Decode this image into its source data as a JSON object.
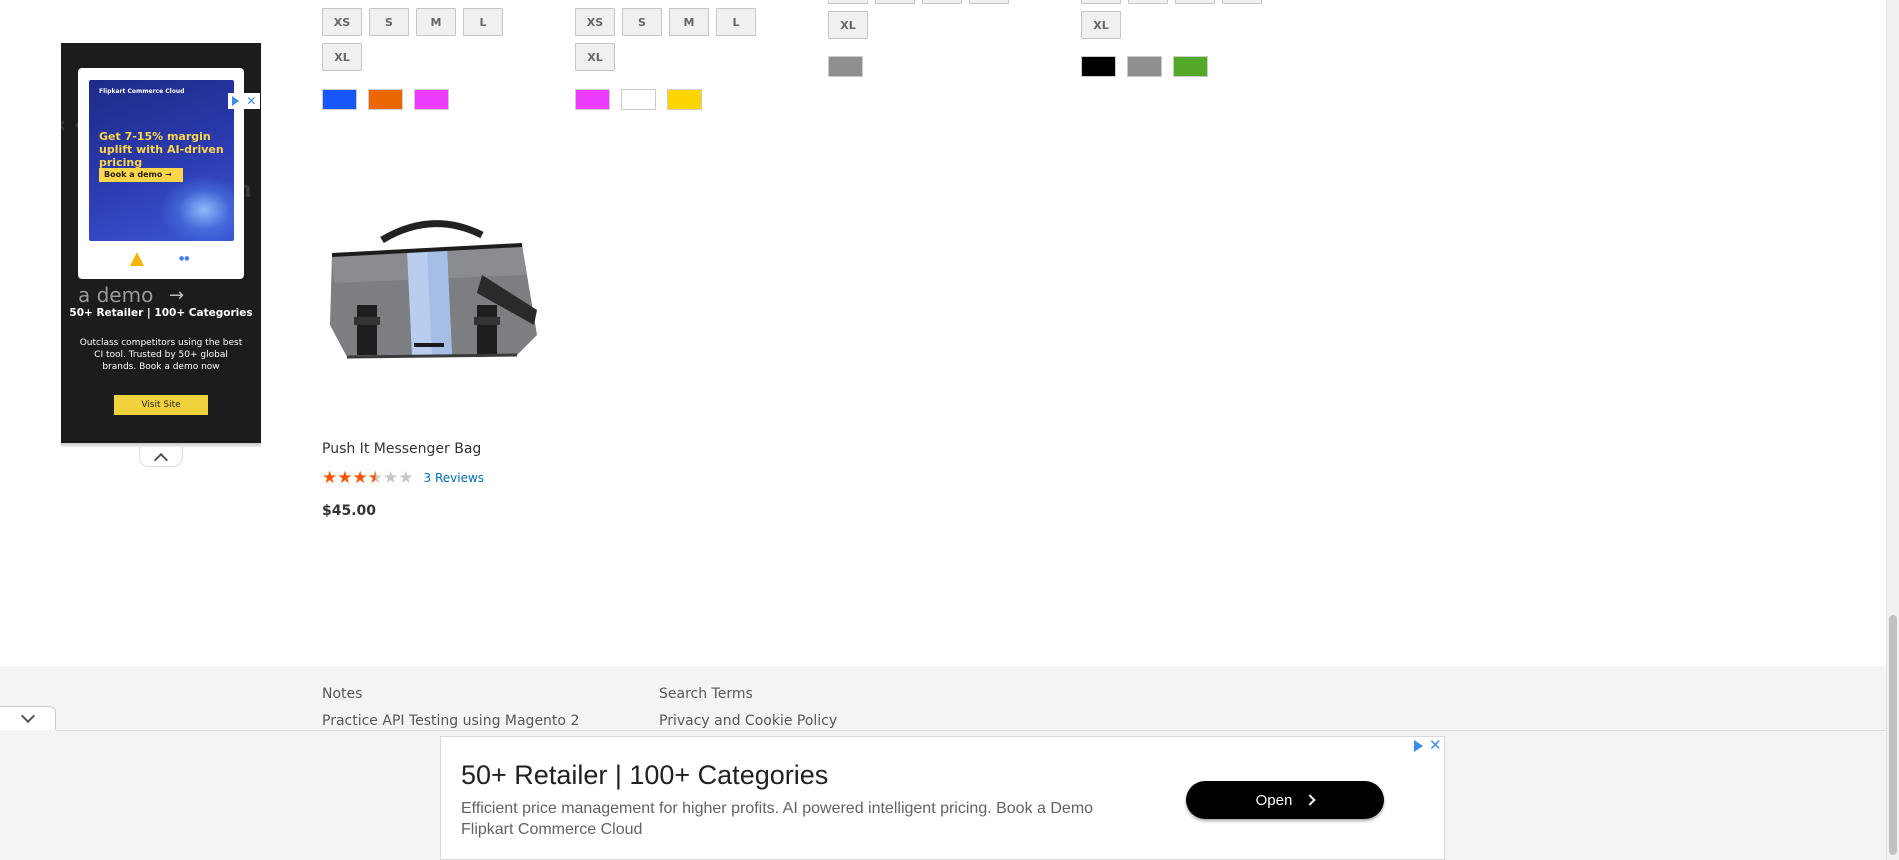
{
  "products_above": [
    {
      "sizes_row1": [
        "XS",
        "S",
        "M",
        "L"
      ],
      "sizes_row2": [
        "XL"
      ],
      "colors": [
        "#1857f7",
        "#eb6703",
        "#ef3dff"
      ]
    },
    {
      "sizes_row1": [
        "XS",
        "S",
        "M",
        "L"
      ],
      "sizes_row2": [
        "XL"
      ],
      "colors": [
        "#ef3dff",
        "#ffffff",
        "#ffd500"
      ]
    },
    {
      "sizes_row2": [
        "XL"
      ],
      "colors": [
        "#8f8f8f"
      ]
    },
    {
      "sizes_row2": [
        "XL"
      ],
      "colors": [
        "#000000",
        "#8f8f8f",
        "#53a828"
      ]
    }
  ],
  "side_ad": {
    "logo_text": "Flipkart Commerce Cloud",
    "card_headline": "Get 7-15% margin uplift with AI-driven pricing",
    "card_cta": "Book a demo →",
    "bg_text": "a demo",
    "title": "50+ Retailer | 100+ Categories",
    "body": "Outclass competitors using the best CI tool. Trusted by 50+ global brands. Book a demo now",
    "cta": "Visit Site"
  },
  "product": {
    "name": "Push It Messenger Bag",
    "rating": 3.5,
    "reviews": "3 Reviews",
    "price": "$45.00"
  },
  "footer": {
    "links_col1": [
      "Notes",
      "Practice API Testing using Magento 2"
    ],
    "links_col2": [
      "Search Terms",
      "Privacy and Cookie Policy"
    ]
  },
  "bottom_ad": {
    "title": "50+ Retailer | 100+ Categories",
    "body_line1": "Efficient price management for higher profits. AI powered intelligent pricing. Book a Demo",
    "body_line2": "Flipkart Commerce Cloud",
    "cta": "Open"
  },
  "colors": {
    "star_on": "#ff5501",
    "link": "#006bb4",
    "footer_bg": "#f4f4f4"
  }
}
